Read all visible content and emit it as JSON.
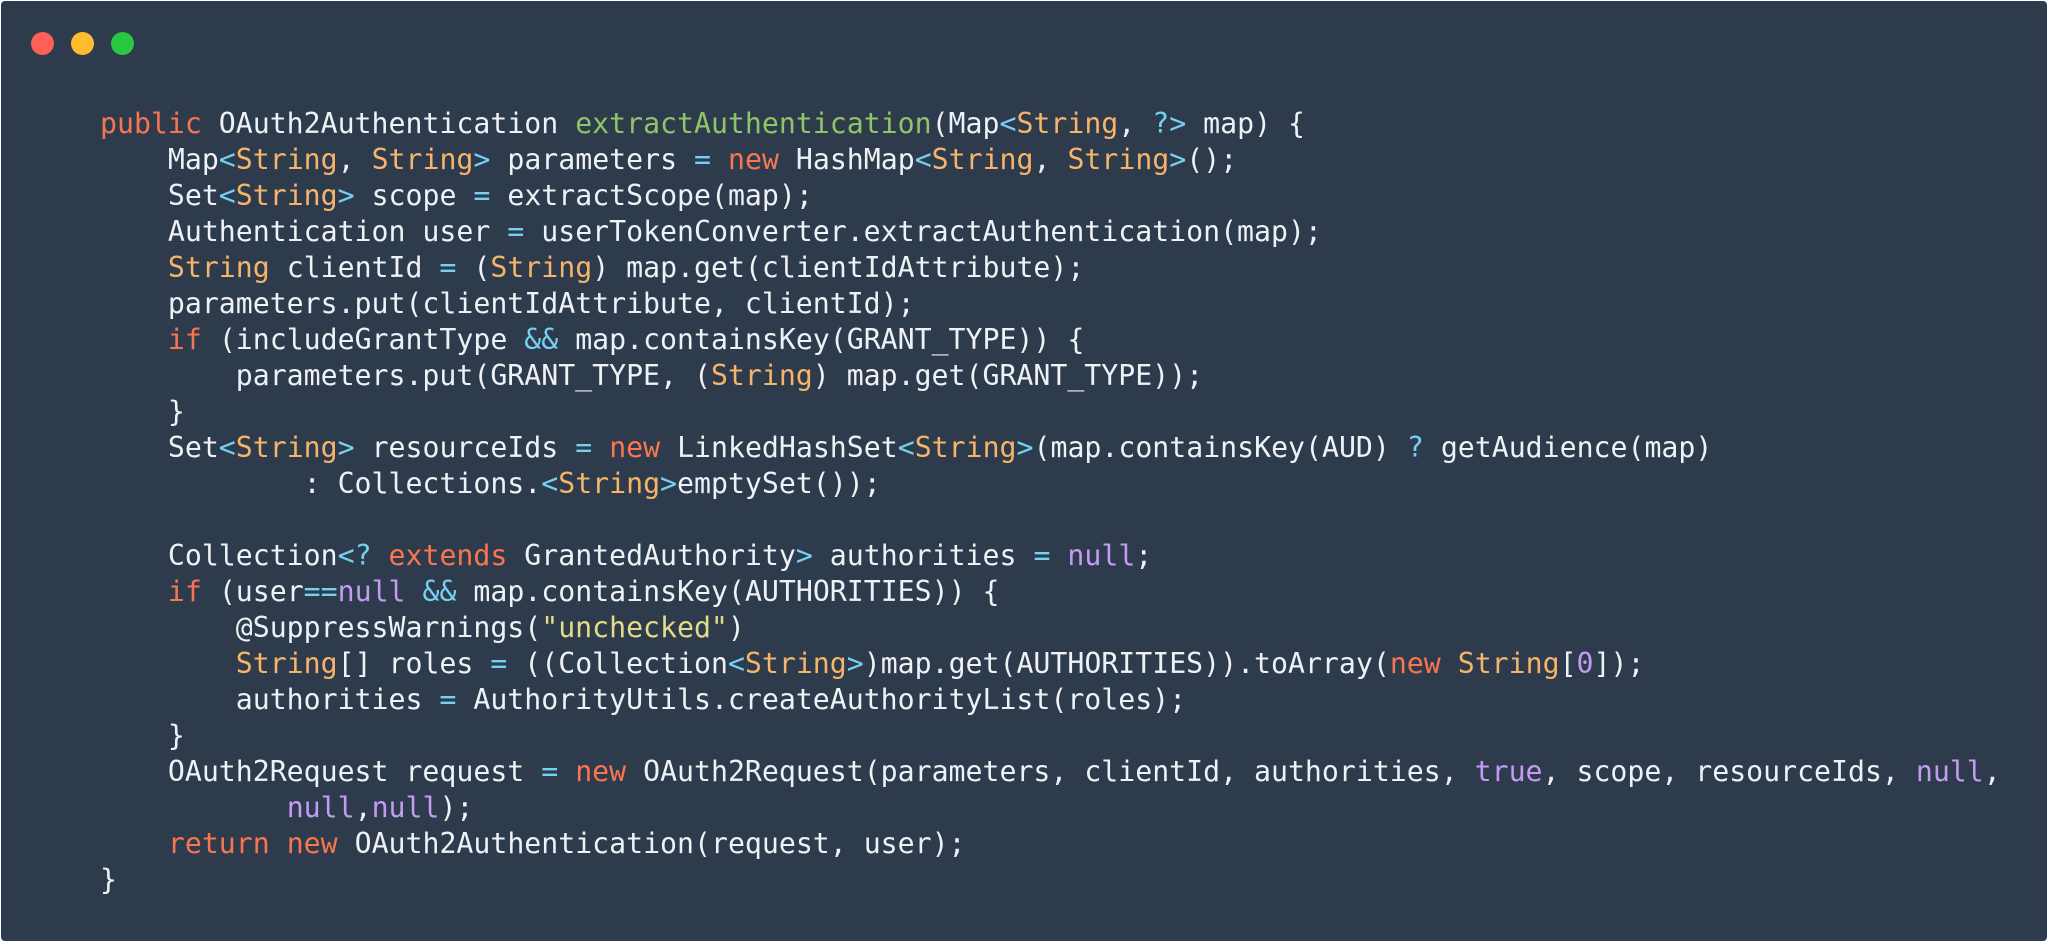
{
  "window": {
    "background": "#2e3b4c",
    "controls": [
      {
        "name": "close",
        "color": "#fe5f57"
      },
      {
        "name": "minimize",
        "color": "#febc2e"
      },
      {
        "name": "maximize",
        "color": "#28c840"
      }
    ]
  },
  "theme": {
    "plain": "#eef1f5",
    "keyword": "#f7764f",
    "type": "#f5b469",
    "function": "#8fc468",
    "operator": "#76d1f1",
    "constant": "#c39cf2",
    "string": "#e2dd88"
  },
  "code_lines": [
    [
      [
        "keyword",
        "public"
      ],
      [
        "plain",
        " OAuth2Authentication "
      ],
      [
        "function",
        "extractAuthentication"
      ],
      [
        "plain",
        "(Map"
      ],
      [
        "operator",
        "<"
      ],
      [
        "type",
        "String"
      ],
      [
        "plain",
        ", "
      ],
      [
        "operator",
        "?>"
      ],
      [
        "plain",
        " map) {"
      ]
    ],
    [
      [
        "plain",
        "    Map"
      ],
      [
        "operator",
        "<"
      ],
      [
        "type",
        "String"
      ],
      [
        "plain",
        ", "
      ],
      [
        "type",
        "String"
      ],
      [
        "operator",
        ">"
      ],
      [
        "plain",
        " parameters "
      ],
      [
        "operator",
        "="
      ],
      [
        "plain",
        " "
      ],
      [
        "keyword",
        "new"
      ],
      [
        "plain",
        " HashMap"
      ],
      [
        "operator",
        "<"
      ],
      [
        "type",
        "String"
      ],
      [
        "plain",
        ", "
      ],
      [
        "type",
        "String"
      ],
      [
        "operator",
        ">"
      ],
      [
        "plain",
        "();"
      ]
    ],
    [
      [
        "plain",
        "    Set"
      ],
      [
        "operator",
        "<"
      ],
      [
        "type",
        "String"
      ],
      [
        "operator",
        ">"
      ],
      [
        "plain",
        " scope "
      ],
      [
        "operator",
        "="
      ],
      [
        "plain",
        " extractScope(map);"
      ]
    ],
    [
      [
        "plain",
        "    Authentication user "
      ],
      [
        "operator",
        "="
      ],
      [
        "plain",
        " userTokenConverter.extractAuthentication(map);"
      ]
    ],
    [
      [
        "plain",
        "    "
      ],
      [
        "type",
        "String"
      ],
      [
        "plain",
        " clientId "
      ],
      [
        "operator",
        "="
      ],
      [
        "plain",
        " ("
      ],
      [
        "type",
        "String"
      ],
      [
        "plain",
        ") map.get(clientIdAttribute);"
      ]
    ],
    [
      [
        "plain",
        "    parameters.put(clientIdAttribute, clientId);"
      ]
    ],
    [
      [
        "plain",
        "    "
      ],
      [
        "keyword",
        "if"
      ],
      [
        "plain",
        " (includeGrantType "
      ],
      [
        "operator",
        "&&"
      ],
      [
        "plain",
        " map.containsKey(GRANT_TYPE)) {"
      ]
    ],
    [
      [
        "plain",
        "        parameters.put(GRANT_TYPE, ("
      ],
      [
        "type",
        "String"
      ],
      [
        "plain",
        ") map.get(GRANT_TYPE));"
      ]
    ],
    [
      [
        "plain",
        "    }"
      ]
    ],
    [
      [
        "plain",
        "    Set"
      ],
      [
        "operator",
        "<"
      ],
      [
        "type",
        "String"
      ],
      [
        "operator",
        ">"
      ],
      [
        "plain",
        " resourceIds "
      ],
      [
        "operator",
        "="
      ],
      [
        "plain",
        " "
      ],
      [
        "keyword",
        "new"
      ],
      [
        "plain",
        " LinkedHashSet"
      ],
      [
        "operator",
        "<"
      ],
      [
        "type",
        "String"
      ],
      [
        "operator",
        ">"
      ],
      [
        "plain",
        "(map.containsKey(AUD) "
      ],
      [
        "operator",
        "?"
      ],
      [
        "plain",
        " getAudience(map)"
      ]
    ],
    [
      [
        "plain",
        "            : Collections."
      ],
      [
        "operator",
        "<"
      ],
      [
        "type",
        "String"
      ],
      [
        "operator",
        ">"
      ],
      [
        "plain",
        "emptySet());"
      ]
    ],
    [],
    [
      [
        "plain",
        "    Collection"
      ],
      [
        "operator",
        "<?"
      ],
      [
        "plain",
        " "
      ],
      [
        "keyword",
        "extends"
      ],
      [
        "plain",
        " GrantedAuthority"
      ],
      [
        "operator",
        ">"
      ],
      [
        "plain",
        " authorities "
      ],
      [
        "operator",
        "="
      ],
      [
        "plain",
        " "
      ],
      [
        "constant",
        "null"
      ],
      [
        "plain",
        ";"
      ]
    ],
    [
      [
        "plain",
        "    "
      ],
      [
        "keyword",
        "if"
      ],
      [
        "plain",
        " (user"
      ],
      [
        "operator",
        "=="
      ],
      [
        "constant",
        "null"
      ],
      [
        "plain",
        " "
      ],
      [
        "operator",
        "&&"
      ],
      [
        "plain",
        " map.containsKey(AUTHORITIES)) {"
      ]
    ],
    [
      [
        "plain",
        "        @SuppressWarnings("
      ],
      [
        "string",
        "\"unchecked\""
      ],
      [
        "plain",
        ")"
      ]
    ],
    [
      [
        "plain",
        "        "
      ],
      [
        "type",
        "String"
      ],
      [
        "plain",
        "[] roles "
      ],
      [
        "operator",
        "="
      ],
      [
        "plain",
        " ((Collection"
      ],
      [
        "operator",
        "<"
      ],
      [
        "type",
        "String"
      ],
      [
        "operator",
        ">"
      ],
      [
        "plain",
        ")map.get(AUTHORITIES)).toArray("
      ],
      [
        "keyword",
        "new"
      ],
      [
        "plain",
        " "
      ],
      [
        "type",
        "String"
      ],
      [
        "plain",
        "["
      ],
      [
        "constant",
        "0"
      ],
      [
        "plain",
        "]);"
      ]
    ],
    [
      [
        "plain",
        "        authorities "
      ],
      [
        "operator",
        "="
      ],
      [
        "plain",
        " AuthorityUtils.createAuthorityList(roles);"
      ]
    ],
    [
      [
        "plain",
        "    }"
      ]
    ],
    [
      [
        "plain",
        "    OAuth2Request request "
      ],
      [
        "operator",
        "="
      ],
      [
        "plain",
        " "
      ],
      [
        "keyword",
        "new"
      ],
      [
        "plain",
        " OAuth2Request(parameters, clientId, authorities, "
      ],
      [
        "constant",
        "true"
      ],
      [
        "plain",
        ", scope, resourceIds, "
      ],
      [
        "constant",
        "null"
      ],
      [
        "plain",
        ","
      ]
    ],
    [
      [
        "plain",
        "           "
      ],
      [
        "constant",
        "null"
      ],
      [
        "plain",
        ","
      ],
      [
        "constant",
        "null"
      ],
      [
        "plain",
        ");"
      ]
    ],
    [
      [
        "plain",
        "    "
      ],
      [
        "keyword",
        "return"
      ],
      [
        "plain",
        " "
      ],
      [
        "keyword",
        "new"
      ],
      [
        "plain",
        " OAuth2Authentication(request, user);"
      ]
    ],
    [
      [
        "plain",
        "}"
      ]
    ]
  ]
}
